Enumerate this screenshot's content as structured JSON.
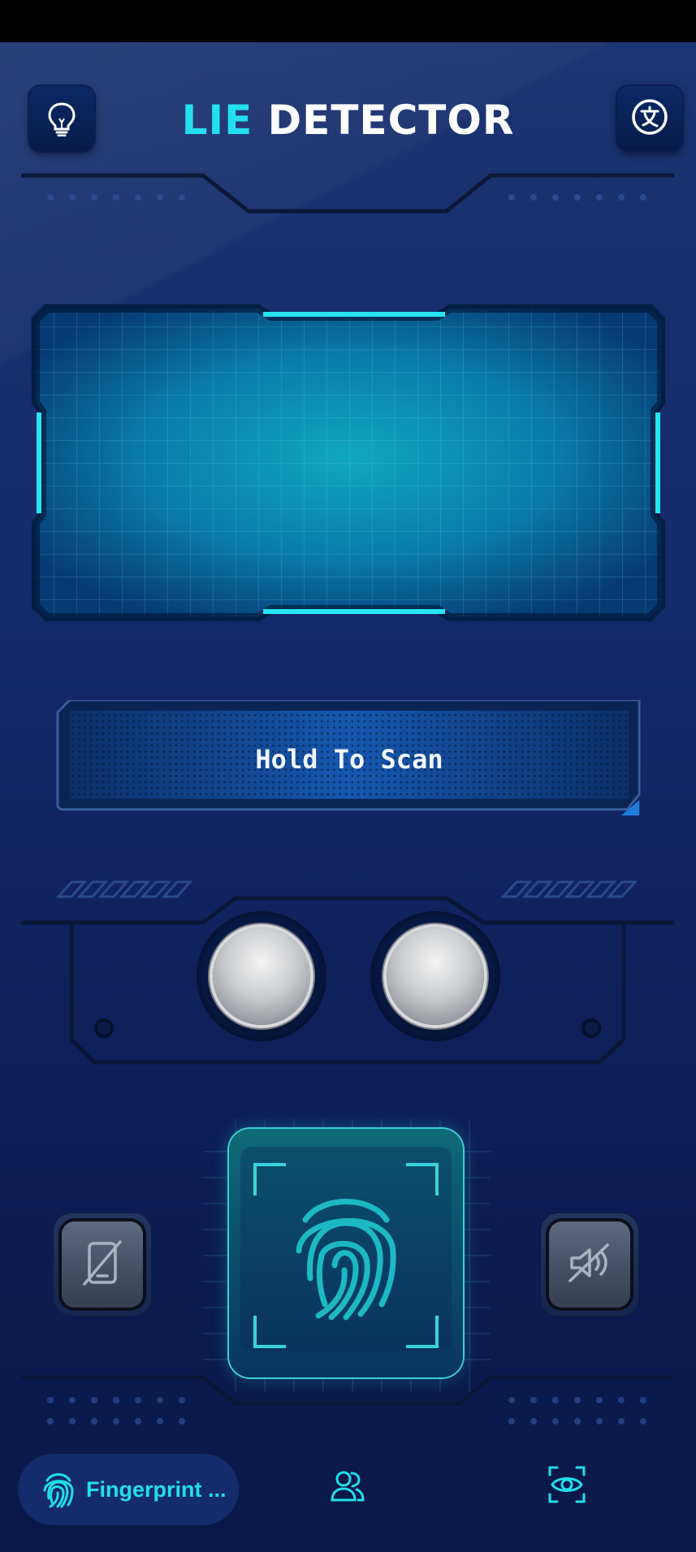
{
  "header": {
    "title_part1": "LIE",
    "title_part2": "DETECTOR",
    "left_button_icon": "lightbulb-icon",
    "right_button_icon": "translate-icon"
  },
  "scan": {
    "prompt": "Hold To Scan"
  },
  "controls": {
    "left_button_icon": "screen-off-icon",
    "right_button_icon": "sound-off-icon",
    "center_icon": "fingerprint-icon"
  },
  "bottom_nav": {
    "items": [
      {
        "label": "Fingerprint ...",
        "icon": "fingerprint-icon",
        "active": true
      },
      {
        "label": "",
        "icon": "users-icon",
        "active": false
      },
      {
        "label": "",
        "icon": "eye-scan-icon",
        "active": false
      }
    ]
  },
  "colors": {
    "accent": "#22e0ef",
    "background": "#14296a",
    "panel": "#0b4f8a"
  }
}
